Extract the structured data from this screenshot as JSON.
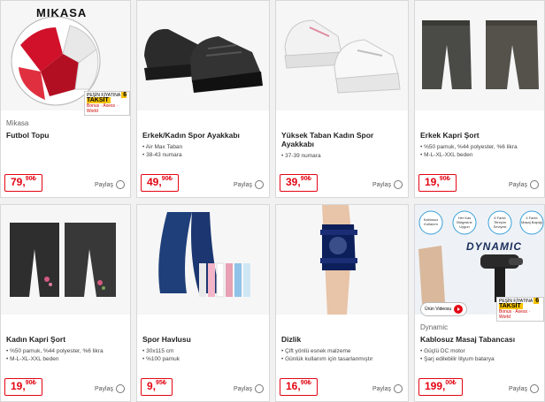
{
  "products": [
    {
      "brand": "Mikasa",
      "title": "Futbol Topu",
      "features": [],
      "price_int": "79,",
      "price_dec": "90₺",
      "share": "Paylaş",
      "image_text": "MIKASA",
      "badge_top": "PEŞİN FİYATINA",
      "badge_main": "6 TAKSİT",
      "badge_cards": "Bonus · Axess · World"
    },
    {
      "brand": "",
      "title": "Erkek/Kadın Spor Ayakkabı",
      "features": [
        "Air Max Taban",
        "38-43 numara"
      ],
      "price_int": "49,",
      "price_dec": "90₺",
      "share": "Paylaş"
    },
    {
      "brand": "",
      "title": "Yüksek Taban Kadın Spor Ayakkabı",
      "features": [
        "37-39 numara"
      ],
      "price_int": "39,",
      "price_dec": "90₺",
      "share": "Paylaş"
    },
    {
      "brand": "",
      "title": "Erkek Kapri Şort",
      "features": [
        "%50 pamuk, %44 polyester, %6 likra",
        "M-L-XL-XXL beden"
      ],
      "price_int": "19,",
      "price_dec": "90₺",
      "share": "Paylaş"
    },
    {
      "brand": "",
      "title": "Kadın Kapri Şort",
      "features": [
        "%50 pamuk, %44 polyester, %6 likra",
        "M-L-XL-XXL beden"
      ],
      "price_int": "19,",
      "price_dec": "90₺",
      "share": "Paylaş"
    },
    {
      "brand": "",
      "title": "Spor Havlusu",
      "features": [
        "30x115 cm",
        "%100 pamuk"
      ],
      "price_int": "9,",
      "price_dec": "95₺",
      "share": "Paylaş"
    },
    {
      "brand": "",
      "title": "Dizlik",
      "features": [
        "Çift yönlü esnek malzeme",
        "Günlük kullanım için tasarlanmıştır"
      ],
      "price_int": "16,",
      "price_dec": "90₺",
      "share": "Paylaş"
    },
    {
      "brand": "Dynamic",
      "title": "Kablosuz Masaj Tabancası",
      "features": [
        "Güçlü DC motor",
        "Şarj edilebilir lityum batarya"
      ],
      "price_int": "199,",
      "price_dec": "00₺",
      "share": "Paylaş",
      "image_text": "DYNAMIC",
      "bubbles": [
        "Kablosuz Kullanım",
        "Her Kas Bölgesine Uygun",
        "6 Farklı Titreşim Seviyesi",
        "4 Farklı Masaj Başlığı"
      ],
      "video_label": "Ürün Videosu",
      "badge_top": "PEŞİN FİYATINA",
      "badge_main": "6 TAKSİT",
      "badge_cards": "Bonus · Axess · World"
    }
  ],
  "colors": {
    "accent": "#e30613",
    "badge": "#f6c200"
  }
}
